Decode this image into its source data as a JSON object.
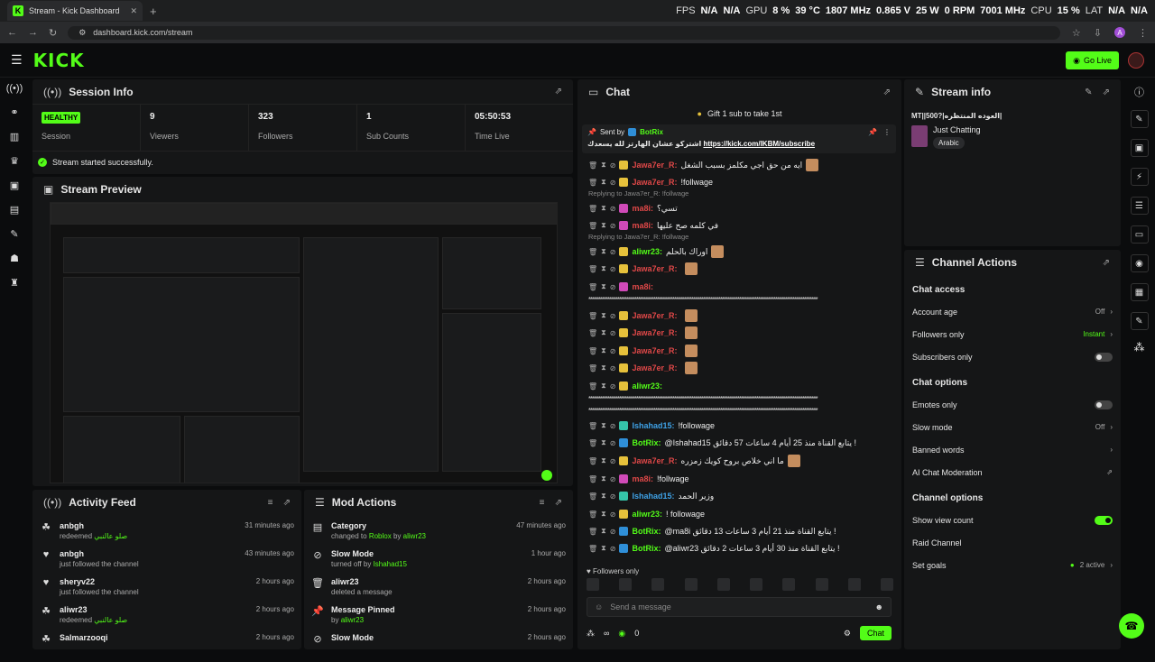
{
  "browser": {
    "tab_title": "Stream - Kick Dashboard",
    "url": "dashboard.kick.com/stream",
    "profile_letter": "A"
  },
  "overlay": {
    "items": [
      "FPS",
      "N/A",
      "N/A",
      "GPU",
      "8 %",
      "39 °C",
      "1807 MHz",
      "0.865 V",
      "25 W",
      "0 RPM",
      "7001 MHz",
      "CPU",
      "15 %",
      "LAT",
      "N/A",
      "N/A"
    ]
  },
  "header": {
    "logo": "KICK",
    "go_live": "Go Live"
  },
  "session": {
    "title": "Session Info",
    "stats": [
      {
        "value": "HEALTHY",
        "label": "Session"
      },
      {
        "value": "9",
        "label": "Viewers"
      },
      {
        "value": "323",
        "label": "Followers"
      },
      {
        "value": "1",
        "label": "Sub Counts"
      },
      {
        "value": "05:50:53",
        "label": "Time Live"
      }
    ],
    "status": "Stream started successfully."
  },
  "preview": {
    "title": "Stream Preview"
  },
  "activity": {
    "title": "Activity Feed",
    "items": [
      {
        "icon": "☘",
        "name": "anbgh",
        "sub": "redeemed",
        "extra": "صلو عالنبي",
        "time": "31 minutes ago"
      },
      {
        "icon": "♥",
        "name": "anbgh",
        "sub": "just followed the channel",
        "extra": "",
        "time": "43 minutes ago"
      },
      {
        "icon": "♥",
        "name": "sheryv22",
        "sub": "just followed the channel",
        "extra": "",
        "time": "2 hours ago"
      },
      {
        "icon": "☘",
        "name": "aliwr23",
        "sub": "redeemed",
        "extra": "صلو عالنبي",
        "time": "2 hours ago"
      },
      {
        "icon": "☘",
        "name": "Salmarzooqi",
        "sub": "",
        "extra": "",
        "time": "2 hours ago"
      }
    ]
  },
  "mod": {
    "title": "Mod Actions",
    "items": [
      {
        "icon": "▤",
        "name": "Category",
        "sub": "changed to",
        "g1": "Roblox",
        "mid": "by",
        "g2": "aliwr23",
        "time": "47 minutes ago"
      },
      {
        "icon": "⊘",
        "name": "Slow Mode",
        "sub": "turned off by",
        "g1": "Ishahad15",
        "mid": "",
        "g2": "",
        "time": "1 hour ago"
      },
      {
        "icon": "🗑",
        "name": "aliwr23",
        "sub": "deleted a message",
        "g1": "",
        "mid": "",
        "g2": "",
        "time": "2 hours ago"
      },
      {
        "icon": "📌",
        "name": "Message Pinned",
        "sub": "by",
        "g1": "aliwr23",
        "mid": "",
        "g2": "",
        "time": "2 hours ago"
      },
      {
        "icon": "⊘",
        "name": "Slow Mode",
        "sub": "",
        "g1": "",
        "mid": "",
        "g2": "",
        "time": "2 hours ago"
      }
    ]
  },
  "chat": {
    "title": "Chat",
    "gift": "Gift 1 sub to take 1st",
    "pinned": {
      "sent_by": "Sent by",
      "user": "BotRix",
      "text": "اشتركو عشان الهارتز لله يسعدك",
      "link": "https://kick.com/IKBM/subscribe"
    },
    "messages": [
      {
        "user": "Jawa7er_R:",
        "color": "#e04848",
        "badge": "bdy",
        "text": "ايه من حق اجي مكلمز بسبب الشغل",
        "emote": true
      },
      {
        "user": "Jawa7er_R:",
        "color": "#e04848",
        "badge": "bdy",
        "text": "!follwage",
        "emote": false
      },
      {
        "user": "ma8i:",
        "color": "#e04848",
        "badge": "bdp",
        "text": "تسي؟",
        "emote": false
      },
      {
        "user": "ma8i:",
        "color": "#e04848",
        "badge": "bdp",
        "text": "في كلمه صح عليها",
        "emote": false
      },
      {
        "user": "aliwr23:",
        "color": "#53fc18",
        "badge": "bdy",
        "text": "اوراك بالحلم",
        "emote": true
      },
      {
        "user": "Jawa7er_R:",
        "color": "#e04848",
        "badge": "bdy",
        "text": "",
        "emote": true
      },
      {
        "user": "ma8i:",
        "color": "#e04848",
        "badge": "bdp",
        "text": "",
        "emote": false
      },
      {
        "user": "Jawa7er_R:",
        "color": "#e04848",
        "badge": "bdy",
        "text": "",
        "emote": true
      },
      {
        "user": "Jawa7er_R:",
        "color": "#e04848",
        "badge": "bdy",
        "text": "",
        "emote": true
      },
      {
        "user": "Jawa7er_R:",
        "color": "#e04848",
        "badge": "bdy",
        "text": "",
        "emote": true
      },
      {
        "user": "Jawa7er_R:",
        "color": "#e04848",
        "badge": "bdy",
        "text": "",
        "emote": true
      },
      {
        "user": "aliwr23:",
        "color": "#53fc18",
        "badge": "bdy",
        "text": "",
        "emote": false
      },
      {
        "user": "Ishahad15:",
        "color": "#3ea1e6",
        "badge": "bdg",
        "text": "!followage",
        "emote": false
      },
      {
        "user": "BotRix:",
        "color": "#53fc18",
        "badge": "bdb",
        "text": "@Ishahad15 يتابع القناة منذ 25 أيام 4 ساعات 57 دقائق !",
        "emote": false
      },
      {
        "user": "Jawa7er_R:",
        "color": "#e04848",
        "badge": "bdy",
        "text": "ما اني خلاص بروح كويك زمزره",
        "emote": true
      },
      {
        "user": "ma8i:",
        "color": "#e04848",
        "badge": "bdp",
        "text": "!follwage",
        "emote": false
      },
      {
        "user": "Ishahad15:",
        "color": "#3ea1e6",
        "badge": "bdg",
        "text": "وزير الحمد",
        "emote": false
      },
      {
        "user": "aliwr23:",
        "color": "#53fc18",
        "badge": "bdy",
        "text": "! followage",
        "emote": false
      },
      {
        "user": "BotRix:",
        "color": "#53fc18",
        "badge": "bdb",
        "text": "@ma8i يتابع القناة منذ 21 أيام 3 ساعات 13 دقائق !",
        "emote": false
      },
      {
        "user": "BotRix:",
        "color": "#53fc18",
        "badge": "bdb",
        "text": "@aliwr23 يتابع القناة منذ 30 أيام 3 ساعات 2 دقائق !",
        "emote": false
      }
    ],
    "replies": [
      "Replying to Jawa7er_R: !follwage",
      "Replying to Jawa7er_R: !follwage"
    ],
    "followers_only": "Followers only",
    "input_placeholder": "Send a message",
    "points": "0",
    "chat_button": "Chat"
  },
  "stream_info": {
    "title": "Stream info",
    "stream_title": "MT||500?|العوده المنتظره|",
    "category": "Just Chatting",
    "tag": "Arabic"
  },
  "channel": {
    "title": "Channel Actions",
    "access_h": "Chat access",
    "account_age": {
      "label": "Account age",
      "value": "Off"
    },
    "followers_only": {
      "label": "Followers only",
      "value": "Instant"
    },
    "subscribers_only": {
      "label": "Subscribers only"
    },
    "options_h": "Chat options",
    "emotes_only": {
      "label": "Emotes only"
    },
    "slow_mode": {
      "label": "Slow mode",
      "value": "Off"
    },
    "banned_words": {
      "label": "Banned words"
    },
    "ai_mod": {
      "label": "AI Chat Moderation"
    },
    "channel_h": "Channel options",
    "show_view_count": {
      "label": "Show view count"
    },
    "raid": {
      "label": "Raid Channel"
    },
    "set_goals": {
      "label": "Set goals",
      "value": "2 active"
    }
  }
}
